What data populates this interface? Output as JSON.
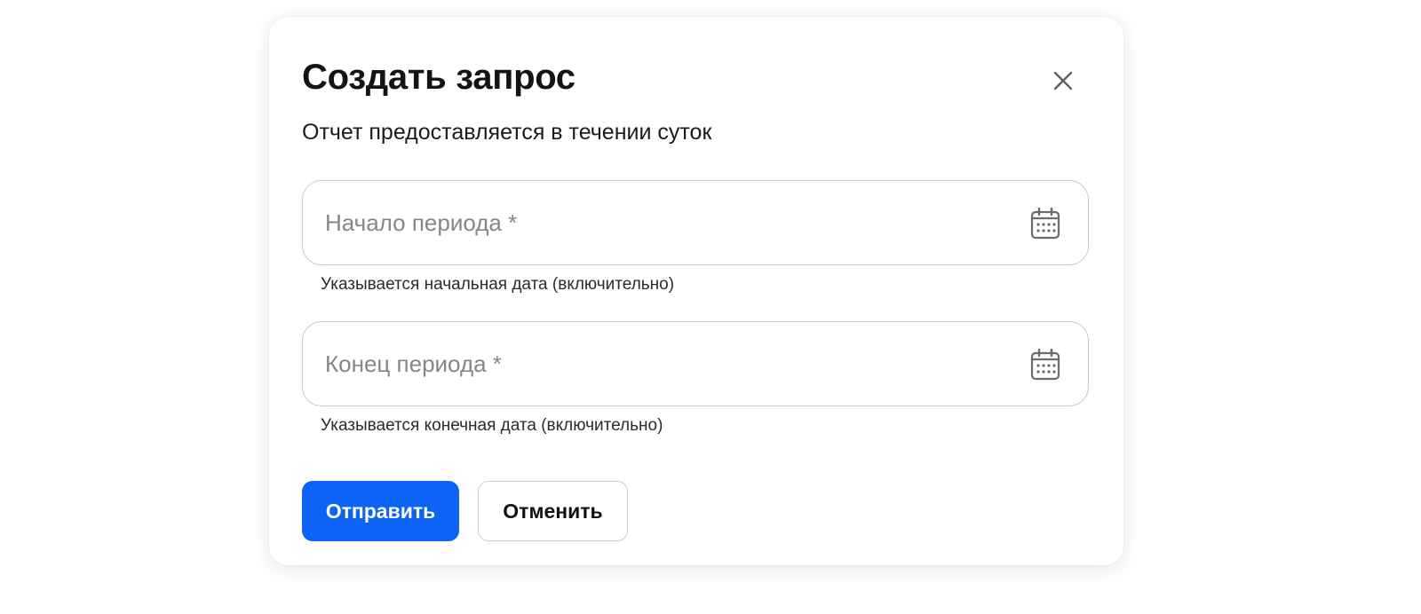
{
  "dialog": {
    "title": "Создать запрос",
    "subtitle": "Отчет предоставляется в течении суток",
    "close_icon": "close-icon"
  },
  "fields": {
    "start": {
      "value": "",
      "placeholder": "Начало периода *",
      "hint": "Указывается начальная дата (включительно)",
      "icon": "calendar-icon"
    },
    "end": {
      "value": "",
      "placeholder": "Конец периода *",
      "hint": "Указывается конечная дата (включительно)",
      "icon": "calendar-icon"
    }
  },
  "actions": {
    "submit_label": "Отправить",
    "cancel_label": "Отменить"
  },
  "colors": {
    "primary": "#0d63f5",
    "border": "#c8c8cc",
    "placeholder": "#85868c",
    "text": "#141414"
  }
}
